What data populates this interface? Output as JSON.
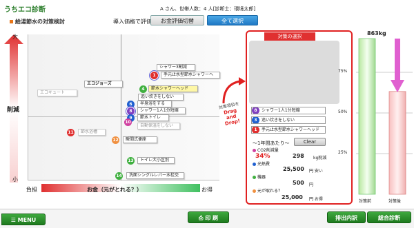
{
  "header": {
    "app_title": "うちエコ診断",
    "user_info": "A さん、世帯人数：4 人[診断士：環境太郎]",
    "subtitle": "給湯節水の対策検討",
    "eval_label": "導入価格で評価",
    "money_toggle_label": "お金評価切替",
    "select_all_label": "全て選択"
  },
  "axis": {
    "top": "大",
    "mid": "削減",
    "bottom": "小",
    "left": "負担",
    "money": "お金（元がとれる？）",
    "right": "お得"
  },
  "plot_items": [
    {
      "num": "",
      "label": "エコキュート",
      "color": ""
    },
    {
      "num": "",
      "label": "エコジョーズ",
      "color": ""
    },
    {
      "num": "",
      "label": "シャワー3割減",
      "color": ""
    },
    {
      "num": "1",
      "label": "手元止水型節水シャワーヘ",
      "color": "#e03030"
    },
    {
      "num": "4",
      "label": "節水シャワーヘッド",
      "color": "#40b040"
    },
    {
      "num": "",
      "label": "追い炊きをしない",
      "color": ""
    },
    {
      "num": "6",
      "label": "半身浴をする",
      "color": "#2060d0"
    },
    {
      "num": "8",
      "label": "シャワー1人1分短縮",
      "color": "#8040c0"
    },
    {
      "num": "9",
      "label": "節水トイレ",
      "color": "#2060d0"
    },
    {
      "num": "10",
      "label": "自動保温をしない",
      "color": "#d040a0"
    },
    {
      "num": "11",
      "label": "節水浴槽",
      "color": "#e03030"
    },
    {
      "num": "12",
      "label": "瞬間式便座",
      "color": "#f09040"
    },
    {
      "num": "13",
      "label": "トイレ大小区別",
      "color": "#40b040"
    },
    {
      "num": "14",
      "label": "洗面シングルレバー水栓交",
      "color": "#40b040"
    }
  ],
  "drag_hint": {
    "line1": "対策項目を",
    "line2": "Drag",
    "line3": "and",
    "line4": "Drop!"
  },
  "panel": {
    "title": "対策の選択",
    "selected": [
      {
        "num": "8",
        "label": "シャワー1人1分短縮",
        "color": "#8040c0"
      },
      {
        "num": "3",
        "label": "追い炊きをしない",
        "color": "#2060d0"
      },
      {
        "num": "1",
        "label": "手元止水型節水シャワーヘッド",
        "color": "#e03030"
      }
    ],
    "yearly_label": "～1年間あたり～",
    "clear_label": "Clear",
    "co2_label": "CO2削減量",
    "co2_pct": "34%",
    "co2_value": "298",
    "co2_unit": "kg削減",
    "heat_label": "光熱費",
    "heat_value": "25,500",
    "heat_unit": "円 安い",
    "device_label": "機器",
    "device_value": "500",
    "device_unit": "円",
    "payback_label": "元が取れる？",
    "payback_value": "25,000",
    "payback_unit": "円 お得"
  },
  "compare": {
    "total": "863kg",
    "ticks": [
      "75%",
      "50%",
      "25%"
    ],
    "before_label": "対策前",
    "after_label": "対策後",
    "after_fraction": 0.66
  },
  "footer": {
    "menu_label": "MENU",
    "print_label": "印 刷",
    "report_label": "排出内訳",
    "diagnosis_label": "総合診断"
  },
  "colors": {
    "brand_green": "#2a7d2a",
    "accent_red": "#e02020",
    "accent_blue": "#1f78c4"
  }
}
